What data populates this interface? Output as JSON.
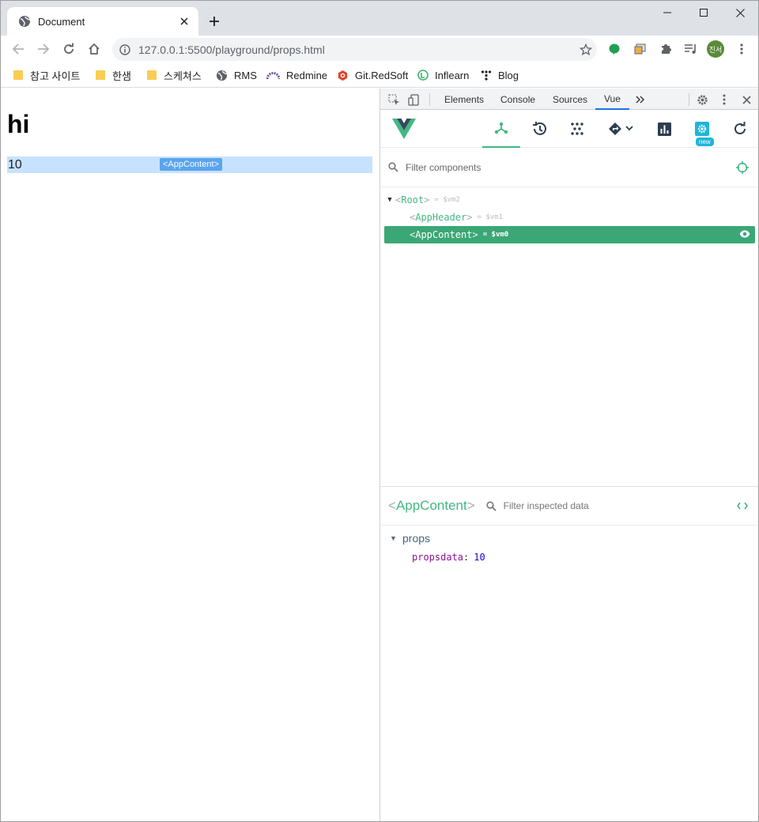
{
  "browser": {
    "tab_title": "Document",
    "url": "127.0.0.1:5500/playground/props.html",
    "profile_initials": "진서"
  },
  "bookmarks": [
    {
      "label": "참고 사이트",
      "icon": "folder-icon"
    },
    {
      "label": "한샘",
      "icon": "folder-icon"
    },
    {
      "label": "스케쳐스",
      "icon": "folder-icon"
    },
    {
      "label": "RMS",
      "icon": "globe-icon"
    },
    {
      "label": "Redmine",
      "icon": "redmine-icon"
    },
    {
      "label": "Git.RedSoft",
      "icon": "gitlab-icon"
    },
    {
      "label": "Inflearn",
      "icon": "inflearn-icon"
    },
    {
      "label": "Blog",
      "icon": "tistory-icon"
    }
  ],
  "page": {
    "heading": "hi",
    "content_value": "10",
    "overlay_tag": "<AppContent>"
  },
  "devtools": {
    "tabs": [
      "Elements",
      "Console",
      "Sources",
      "Vue"
    ],
    "active_tab": "Vue",
    "filter_placeholder": "Filter components",
    "new_badge": "new",
    "tree": [
      {
        "name": "Root",
        "vm": "= $vm2",
        "expanded": true
      },
      {
        "name": "AppHeader",
        "vm": "= $vm1"
      },
      {
        "name": "AppContent",
        "vm": "= $vm0",
        "selected": true
      }
    ],
    "inspector": {
      "component": "AppContent",
      "filter_placeholder": "Filter inspected data",
      "section": "props",
      "props": [
        {
          "key": "propsdata",
          "value": "10"
        }
      ]
    }
  },
  "colors": {
    "vue_green": "#42b883",
    "selected_row": "#3ba776",
    "highlight": "#c7e2ff"
  }
}
